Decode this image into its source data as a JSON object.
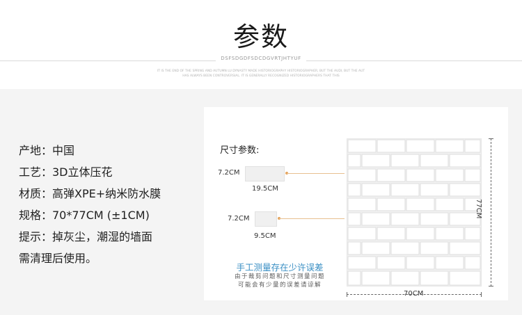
{
  "header": {
    "title": "参数",
    "subtitle": "DSFSDGDFSDCDGVRTJHTYUF",
    "tiny_line_1": "IT IS THE END OF THE SPRING AND AUTUMN LU DYNASTY MADE HISTORIOGRAPHY HISTORIOGRAPHER, BUT THE AUDI, BUT THE AUT",
    "tiny_line_2": "HAS ALWAYS BEEN CONTROVERSIAL. IT IS GENERALLY RECOGNIZED HISTORIOGRAPHERS THAT THIS"
  },
  "specs": {
    "origin": "产地：中国",
    "craft": "工艺：3D立体压花",
    "material": "材质：高弹XPE+纳米防水膜",
    "size": "规格：70*77CM (±1CM)",
    "tip_line_1": "提示：掉灰尘，潮湿的墙面",
    "tip_line_2": "需清理后使用。"
  },
  "diagram": {
    "size_title": "尺寸参数:",
    "sample1_height": "7.2CM",
    "sample1_width": "19.5CM",
    "sample2_height": "7.2CM",
    "sample2_width": "9.5CM",
    "panel_width": "70CM",
    "panel_height": "77CM",
    "note_title": "手工测量存在少许误差",
    "note_line_1": "由于裁剪问题和尺寸测量问题",
    "note_line_2": "可能会有少量的误差请谅解"
  },
  "colors": {
    "accent_blue": "#3a8fc4",
    "arrow_orange": "#e5a55e"
  }
}
